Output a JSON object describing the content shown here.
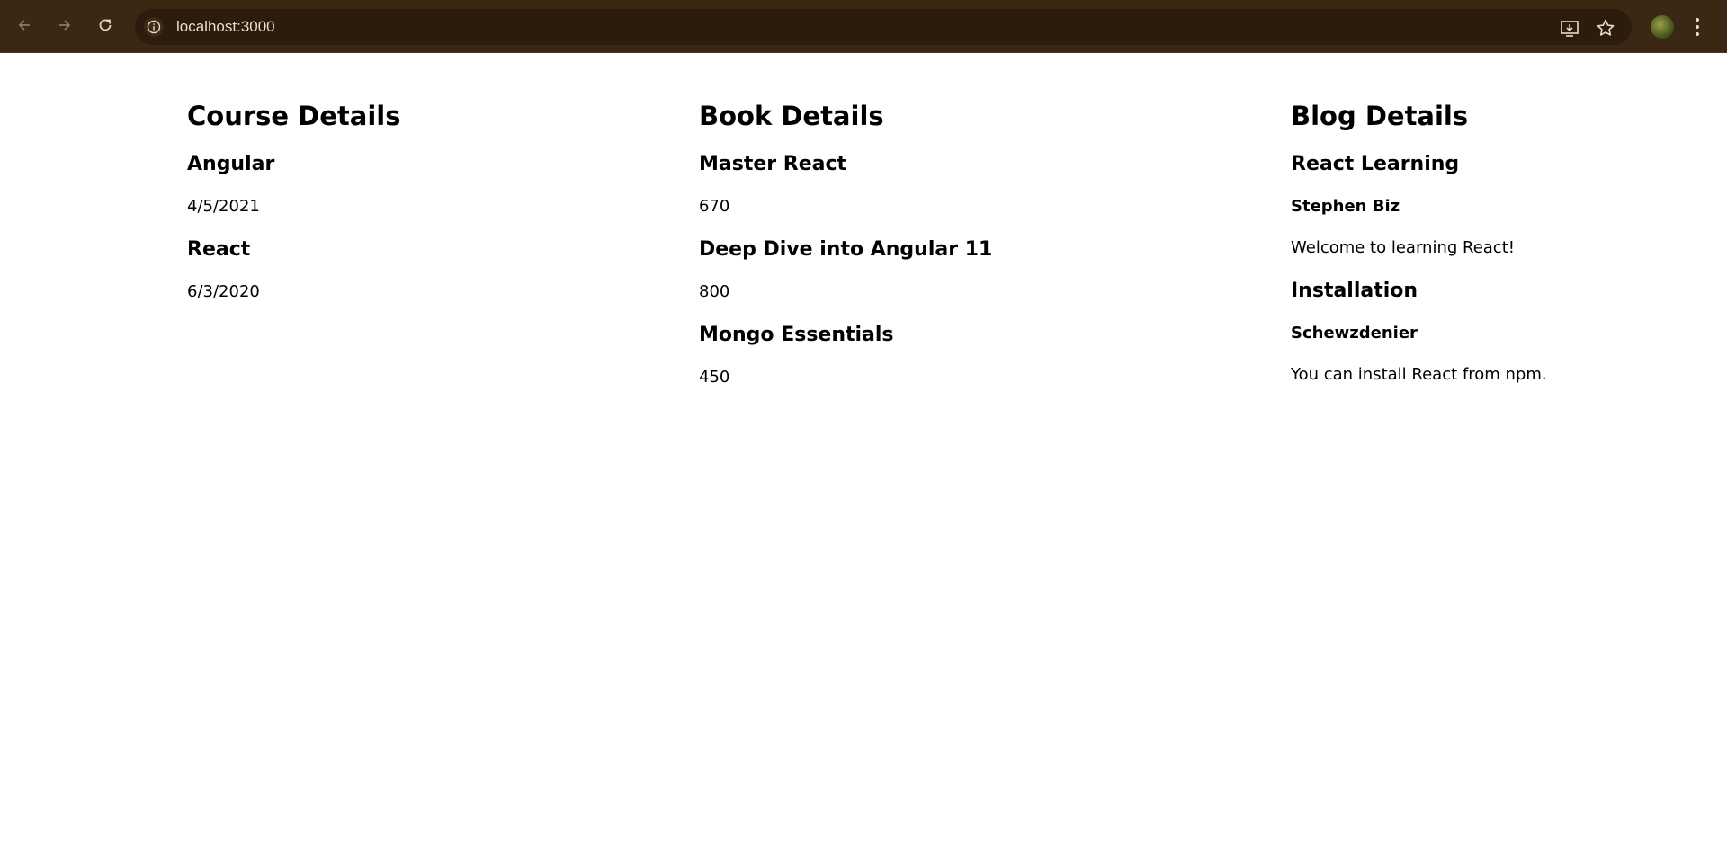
{
  "browser": {
    "url": "localhost:3000"
  },
  "course": {
    "heading": "Course Details",
    "items": [
      {
        "name": "Angular",
        "date": "4/5/2021"
      },
      {
        "name": "React",
        "date": "6/3/2020"
      }
    ]
  },
  "book": {
    "heading": "Book Details",
    "items": [
      {
        "name": "Master React",
        "price": "670"
      },
      {
        "name": "Deep Dive into Angular 11",
        "price": "800"
      },
      {
        "name": "Mongo Essentials",
        "price": "450"
      }
    ]
  },
  "blog": {
    "heading": "Blog Details",
    "items": [
      {
        "title": "React Learning",
        "author": "Stephen Biz",
        "content": "Welcome to learning React!"
      },
      {
        "title": "Installation",
        "author": "Schewzdenier",
        "content": "You can install React from npm."
      }
    ]
  }
}
